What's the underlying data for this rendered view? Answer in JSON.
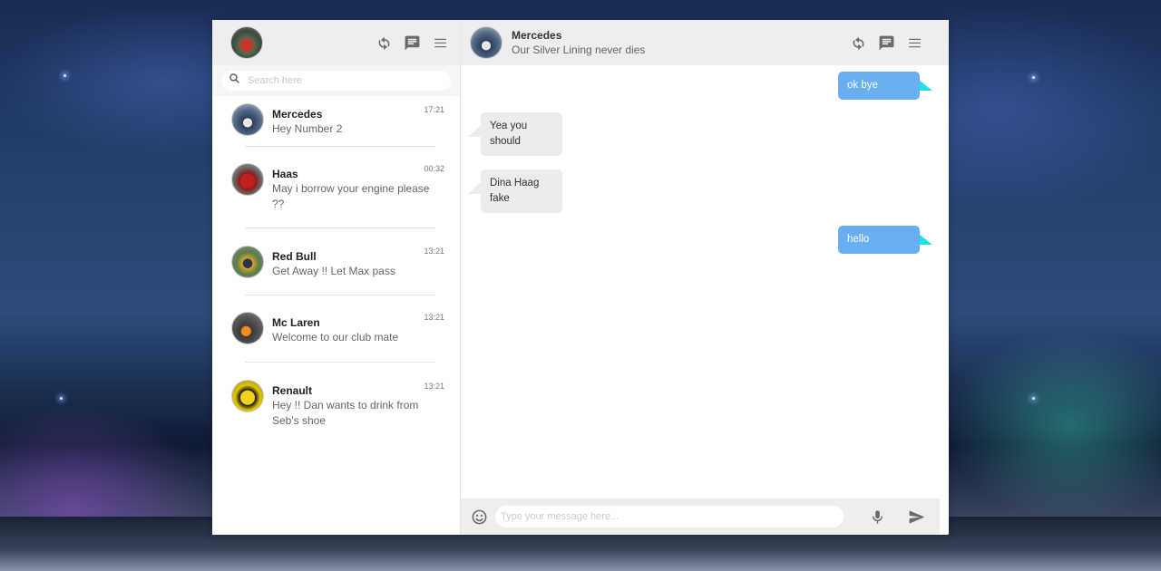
{
  "sidebar": {
    "search": {
      "placeholder": "Search here"
    },
    "chats": [
      {
        "name": "Mercedes",
        "message": "Hey Number 2",
        "time": "17:21"
      },
      {
        "name": "Haas",
        "message": "May i borrow your engine please ??",
        "time": "00:32"
      },
      {
        "name": "Red Bull",
        "message": "Get Away !! Let Max pass",
        "time": "13:21"
      },
      {
        "name": "Mc Laren",
        "message": "Welcome to our club mate",
        "time": "13:21"
      },
      {
        "name": "Renault",
        "message": "Hey !! Dan wants to drink from Seb's shoe",
        "time": "13:21"
      }
    ]
  },
  "conversation": {
    "name": "Mercedes",
    "status": "Our Silver Lining never dies",
    "messages": [
      {
        "direction": "sent",
        "text": "ok bye"
      },
      {
        "direction": "received",
        "text": "Yea you should"
      },
      {
        "direction": "received",
        "text": "Dina Haag fake"
      },
      {
        "direction": "sent",
        "text": "hello"
      }
    ]
  },
  "composer": {
    "placeholder": "Type your message here..."
  },
  "colors": {
    "sent_bubble": "#6aaef2",
    "sent_tail": "#1be1e6",
    "received_bubble": "#ececec",
    "header_bg": "#eeeeee"
  },
  "icons": [
    "refresh-icon",
    "chat-icon",
    "menu-icon",
    "search-icon",
    "emoji-icon",
    "microphone-icon",
    "send-icon"
  ]
}
